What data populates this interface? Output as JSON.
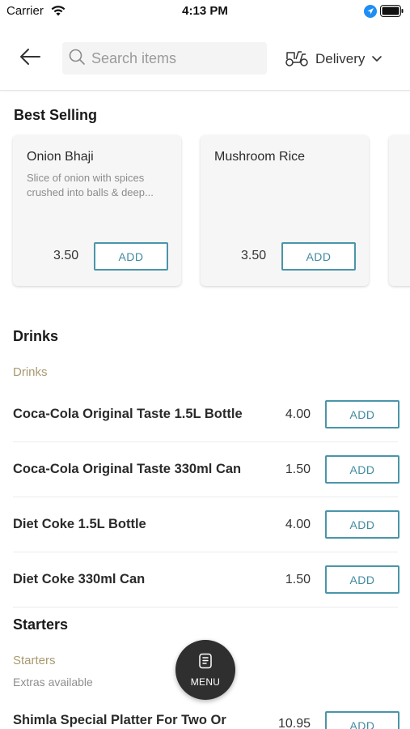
{
  "status_bar": {
    "carrier": "Carrier",
    "time": "4:13 PM"
  },
  "header": {
    "search_placeholder": "Search items",
    "delivery_label": "Delivery"
  },
  "best_selling": {
    "title": "Best Selling",
    "items": [
      {
        "name": "Onion Bhaji",
        "description": "Slice of onion with spices crushed into balls & deep...",
        "price": "3.50",
        "add_label": "ADD"
      },
      {
        "name": "Mushroom Rice",
        "description": "",
        "price": "3.50",
        "add_label": "ADD"
      }
    ]
  },
  "drinks": {
    "title": "Drinks",
    "subcategory": "Drinks",
    "items": [
      {
        "name": "Coca-Cola Original Taste 1.5L Bottle",
        "price": "4.00",
        "add_label": "ADD"
      },
      {
        "name": "Coca-Cola Original Taste 330ml Can",
        "price": "1.50",
        "add_label": "ADD"
      },
      {
        "name": "Diet Coke 1.5L Bottle",
        "price": "4.00",
        "add_label": "ADD"
      },
      {
        "name": "Diet Coke 330ml Can",
        "price": "1.50",
        "add_label": "ADD"
      }
    ]
  },
  "starters": {
    "title": "Starters",
    "subcategory": "Starters",
    "extras_note": "Extras available",
    "items": [
      {
        "name": "Shimla Special Platter For Two Or",
        "price": "10.95",
        "add_label": "ADD"
      }
    ]
  },
  "fab": {
    "label": "MENU"
  },
  "colors": {
    "accent": "#4a95a9",
    "subcategory": "#a89a70",
    "fab_bg": "#2f2f2f",
    "location_blue": "#1e8ef5"
  }
}
